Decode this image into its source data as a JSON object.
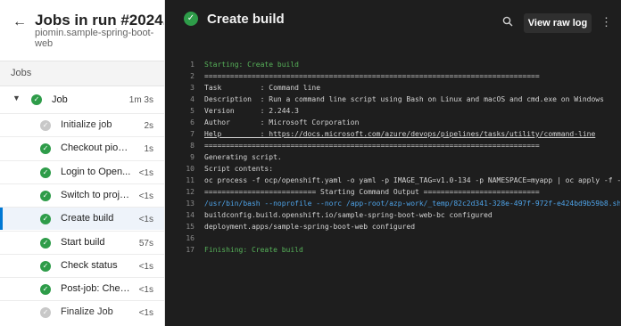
{
  "sidebar": {
    "run_title": "Jobs in run #2024...",
    "run_subtitle": "piomin.sample-spring-boot-web",
    "jobs_label": "Jobs",
    "job": {
      "name": "Job",
      "duration": "1m 3s"
    },
    "steps": [
      {
        "label": "Initialize job",
        "duration": "2s",
        "status": "pending"
      },
      {
        "label": "Checkout piomi...",
        "duration": "1s",
        "status": "success"
      },
      {
        "label": "Login to Open...",
        "duration": "<1s",
        "status": "success"
      },
      {
        "label": "Switch to proje...",
        "duration": "<1s",
        "status": "success"
      },
      {
        "label": "Create build",
        "duration": "<1s",
        "status": "success",
        "selected": true
      },
      {
        "label": "Start build",
        "duration": "57s",
        "status": "success"
      },
      {
        "label": "Check status",
        "duration": "<1s",
        "status": "success"
      },
      {
        "label": "Post-job: Chec...",
        "duration": "<1s",
        "status": "success"
      },
      {
        "label": "Finalize Job",
        "duration": "<1s",
        "status": "pending"
      }
    ]
  },
  "main": {
    "title": "Create build",
    "raw_log_label": "View raw log"
  },
  "log": [
    {
      "n": "1",
      "t": "Starting: Create build",
      "style": "green"
    },
    {
      "n": "2",
      "t": "==============================================================================",
      "style": ""
    },
    {
      "n": "3",
      "t": "Task         : Command line",
      "style": ""
    },
    {
      "n": "4",
      "t": "Description  : Run a command line script using Bash on Linux and macOS and cmd.exe on Windows",
      "style": ""
    },
    {
      "n": "5",
      "t": "Version      : 2.244.3",
      "style": ""
    },
    {
      "n": "6",
      "t": "Author       : Microsoft Corporation",
      "style": ""
    },
    {
      "n": "7",
      "t": "Help         : https://docs.microsoft.com/azure/devops/pipelines/tasks/utility/command-line",
      "style": "link"
    },
    {
      "n": "8",
      "t": "==============================================================================",
      "style": ""
    },
    {
      "n": "9",
      "t": "Generating script.",
      "style": ""
    },
    {
      "n": "10",
      "t": "Script contents:",
      "style": ""
    },
    {
      "n": "11",
      "t": "oc process -f ocp/openshift.yaml -o yaml -p IMAGE_TAG=v1.0-134 -p NAMESPACE=myapp | oc apply -f -",
      "style": ""
    },
    {
      "n": "12",
      "t": "========================== Starting Command Output ===========================",
      "style": ""
    },
    {
      "n": "13",
      "t": "/usr/bin/bash --noprofile --norc /app-root/azp-work/_temp/82c2d341-328e-497f-972f-e424bd9b59b8.sh",
      "style": "blue"
    },
    {
      "n": "14",
      "t": "buildconfig.build.openshift.io/sample-spring-boot-web-bc configured",
      "style": ""
    },
    {
      "n": "15",
      "t": "deployment.apps/sample-spring-boot-web configured",
      "style": ""
    },
    {
      "n": "16",
      "t": "",
      "style": ""
    },
    {
      "n": "17",
      "t": "Finishing: Create build",
      "style": "green"
    }
  ],
  "icons": {
    "back": "arrow-left-icon",
    "expand": "chevron-down-icon",
    "success": "check-circle-icon",
    "pending": "pending-circle-icon",
    "search": "search-icon",
    "more": "more-vertical-icon"
  },
  "colors": {
    "success": "#2e9c49",
    "pending": "#c8c8c8",
    "selected_accent": "#0078d4",
    "log_background": "#1e1e1e",
    "log_green": "#57b35a",
    "log_blue": "#4ea3e8"
  }
}
